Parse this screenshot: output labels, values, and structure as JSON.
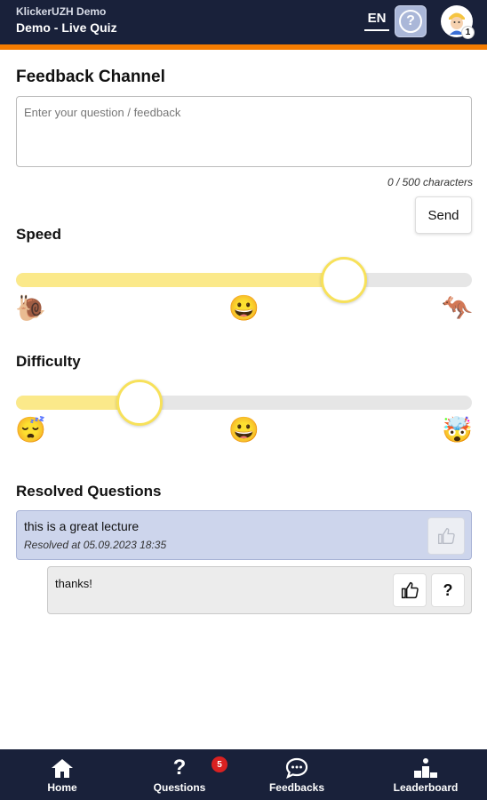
{
  "header": {
    "app_name": "KlickerUZH Demo",
    "session_name": "Demo - Live Quiz",
    "language": "EN",
    "avatar_level": "1"
  },
  "feedback_channel": {
    "title": "Feedback Channel",
    "placeholder": "Enter your question / feedback",
    "value": "",
    "char_count": "0 / 500 characters",
    "send_label": "Send"
  },
  "speed": {
    "title": "Speed",
    "value_fraction": 0.72,
    "emojis": [
      "🐌",
      "😀",
      "🦘"
    ]
  },
  "difficulty": {
    "title": "Difficulty",
    "value_fraction": 0.27,
    "emojis": [
      "😴",
      "😀",
      "🤯"
    ]
  },
  "resolved": {
    "title": "Resolved Questions",
    "items": [
      {
        "text": "this is a great lecture",
        "resolved_at": "Resolved at 05.09.2023 18:35",
        "reply": "thanks!"
      }
    ]
  },
  "bottom_nav": {
    "items": [
      {
        "label": "Home",
        "icon": "home-icon"
      },
      {
        "label": "Questions",
        "icon": "question-icon",
        "badge": "5"
      },
      {
        "label": "Feedbacks",
        "icon": "chat-icon"
      },
      {
        "label": "Leaderboard",
        "icon": "podium-icon"
      }
    ]
  },
  "colors": {
    "header_bg": "#19213a",
    "accent": "#f57c00",
    "slider_fill": "#fbe98a",
    "resolved_card": "#cdd5ec",
    "badge": "#d92121"
  }
}
